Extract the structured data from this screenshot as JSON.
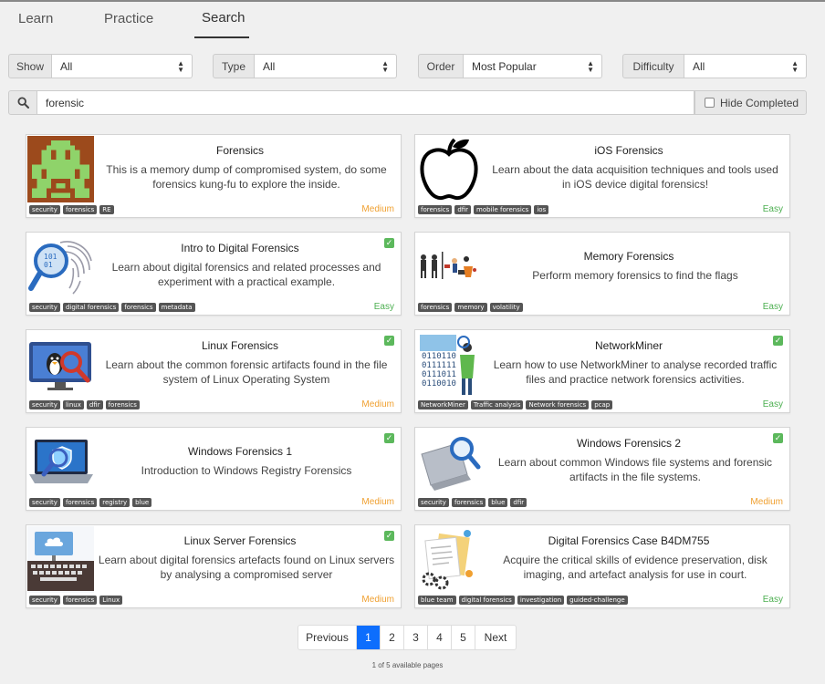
{
  "tabs": [
    {
      "label": "Learn"
    },
    {
      "label": "Practice"
    },
    {
      "label": "Search"
    }
  ],
  "filters": {
    "show": {
      "label": "Show",
      "value": "All"
    },
    "type": {
      "label": "Type",
      "value": "All"
    },
    "order": {
      "label": "Order",
      "value": "Most Popular"
    },
    "difficulty": {
      "label": "Difficulty",
      "value": "All"
    }
  },
  "search": {
    "value": "forensic",
    "hide_completed_label": "Hide Completed"
  },
  "cards": [
    {
      "title": "Forensics",
      "description": "This is a memory dump of compromised system, do some forensics kung-fu to explore the inside.",
      "tags": [
        "security",
        "forensics",
        "RE"
      ],
      "difficulty": "Medium",
      "completed": false,
      "icon": "pixel-alien-icon"
    },
    {
      "title": "iOS Forensics",
      "description": "Learn about the data acquisition techniques and tools used in iOS device digital forensics!",
      "tags": [
        "forensics",
        "dfir",
        "mobile forensics",
        "ios"
      ],
      "difficulty": "Easy",
      "completed": false,
      "icon": "apple-icon"
    },
    {
      "title": "Intro to Digital Forensics",
      "description": "Learn about digital forensics and related processes and experiment with a practical example.",
      "tags": [
        "security",
        "digital forensics",
        "forensics",
        "metadata"
      ],
      "difficulty": "Easy",
      "completed": true,
      "icon": "fingerprint-magnifier-icon"
    },
    {
      "title": "Memory Forensics",
      "description": "Perform memory forensics to find the flags",
      "tags": [
        "forensics",
        "memory",
        "volatility"
      ],
      "difficulty": "Easy",
      "completed": false,
      "icon": "investigators-icon"
    },
    {
      "title": "Linux Forensics",
      "description": "Learn about the common forensic artifacts found in the file system of Linux Operating System",
      "tags": [
        "security",
        "linux",
        "dfir",
        "forensics"
      ],
      "difficulty": "Medium",
      "completed": true,
      "icon": "linux-monitor-icon"
    },
    {
      "title": "NetworkMiner",
      "description": "Learn how to use NetworkMiner to analyse recorded traffic files and practice network forensics activities.",
      "tags": [
        "NetworkMiner",
        "Traffic analysis",
        "Network forensics",
        "pcap"
      ],
      "difficulty": "Easy",
      "completed": true,
      "icon": "binary-analyst-icon"
    },
    {
      "title": "Windows Forensics 1",
      "description": "Introduction to Windows Registry Forensics",
      "tags": [
        "security",
        "forensics",
        "registry",
        "blue"
      ],
      "difficulty": "Medium",
      "completed": true,
      "icon": "laptop-shield-icon"
    },
    {
      "title": "Windows Forensics 2",
      "description": "Learn about common Windows file systems and forensic artifacts in the file systems.",
      "tags": [
        "security",
        "forensics",
        "blue",
        "dfir"
      ],
      "difficulty": "Medium",
      "completed": true,
      "icon": "laptop-magnifier-icon"
    },
    {
      "title": "Linux Server Forensics",
      "description": "Learn about digital forensics artefacts found on Linux servers by analysing a compromised server",
      "tags": [
        "security",
        "forensics",
        "Linux"
      ],
      "difficulty": "Medium",
      "completed": true,
      "icon": "server-keyboard-icon"
    },
    {
      "title": "Digital Forensics Case B4DM755",
      "description": "Acquire the critical skills of evidence preservation, disk imaging, and artefact analysis for use in court.",
      "tags": [
        "blue team",
        "digital forensics",
        "investigation",
        "guided-challenge"
      ],
      "difficulty": "Easy",
      "completed": false,
      "icon": "documents-gears-icon"
    }
  ],
  "pagination": {
    "previous": "Previous",
    "pages": [
      "1",
      "2",
      "3",
      "4",
      "5"
    ],
    "next": "Next",
    "active": "1",
    "info": "1 of 5 available pages"
  },
  "colors": {
    "medium": "#f0a030",
    "easy": "#4caf50",
    "active_page": "#0d6efd",
    "completed_check": "#5cb85c"
  }
}
